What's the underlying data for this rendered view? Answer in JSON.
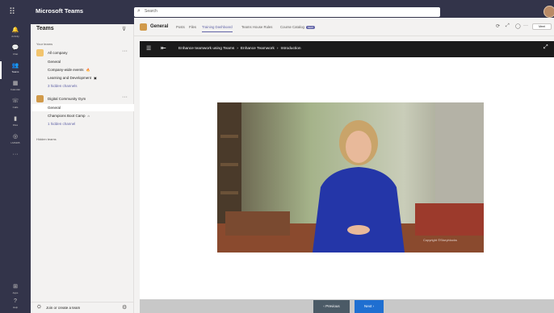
{
  "app": {
    "title": "Microsoft Teams"
  },
  "search": {
    "placeholder": "Search"
  },
  "rail": [
    {
      "icon": "activity-icon",
      "label": "Activity",
      "glyph": "🔔"
    },
    {
      "icon": "chat-icon",
      "label": "Chat",
      "glyph": "💬"
    },
    {
      "icon": "teams-icon",
      "label": "Teams",
      "glyph": "👥"
    },
    {
      "icon": "calendar-icon",
      "label": "Calendar",
      "glyph": "▦"
    },
    {
      "icon": "calls-icon",
      "label": "Calls",
      "glyph": "☏"
    },
    {
      "icon": "files-icon",
      "label": "Files",
      "glyph": "▮"
    },
    {
      "icon": "lms-icon",
      "label": "LMS365",
      "glyph": "◎"
    },
    {
      "icon": "more-apps-icon",
      "label": "",
      "glyph": "···"
    },
    {
      "icon": "apps-icon",
      "label": "Apps",
      "glyph": "⊞"
    },
    {
      "icon": "help-icon",
      "label": "Help",
      "glyph": "?"
    }
  ],
  "panel": {
    "title": "Teams",
    "your_teams": "Your teams",
    "hidden_teams": "Hidden teams",
    "teams": [
      {
        "name": "All company",
        "color": "#f2c46d",
        "channels": [
          {
            "name": "General",
            "badge": ""
          },
          {
            "name": "Company-wide events",
            "badge": "🔥"
          },
          {
            "name": "Learning and Development",
            "badge": "▣"
          }
        ],
        "hidden": "3 hidden channels"
      },
      {
        "name": "Digital Community Gym",
        "color": "#d19a4a",
        "channels": [
          {
            "name": "General",
            "badge": ""
          },
          {
            "name": "Champions Boot Camp",
            "badge": "⌂"
          }
        ],
        "hidden": "1 hidden channel"
      }
    ],
    "footer": "Join or create a team"
  },
  "header": {
    "channel": "General",
    "tabs": [
      "Posts",
      "Files",
      "Training Dashboard",
      "Teams House Rules",
      "Course Catalog"
    ],
    "active_tab": 2,
    "new_badge": "NEW",
    "meet": "Meet"
  },
  "course": {
    "crumbs": [
      "Enhance teamwork using Teams",
      "Enhance Teamwork",
      "Introduction"
    ]
  },
  "video": {
    "watermark": "Copyright ©Storyblocks"
  },
  "nav": {
    "previous": "‹  Previous",
    "next": "Next  ›"
  }
}
